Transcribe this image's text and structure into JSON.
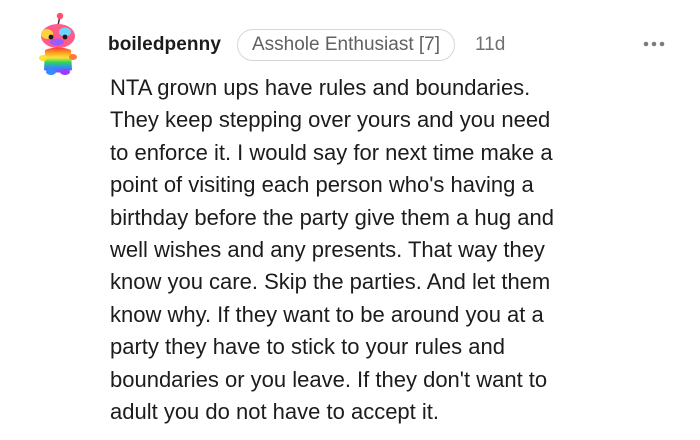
{
  "comment": {
    "username": "boiledpenny",
    "flair": "Asshole Enthusiast [7]",
    "time": "11d",
    "avatar_icon": "snoo-avatar-icon",
    "more_icon": "more-options-icon",
    "body_lines": [
      "NTA grown ups have rules and boundaries.",
      "They keep stepping over yours and you need",
      "to enforce it. I would say for next time make a",
      "point of visiting each person who's having a",
      "birthday before the party give them a hug and",
      "well wishes and any presents. That way they",
      "know you care. Skip the parties. And let them",
      "know why. If they want to be around you at a",
      "party they have to stick to your rules and",
      "boundaries or you leave. If they don't want to",
      "adult you do not have to accept it."
    ]
  }
}
